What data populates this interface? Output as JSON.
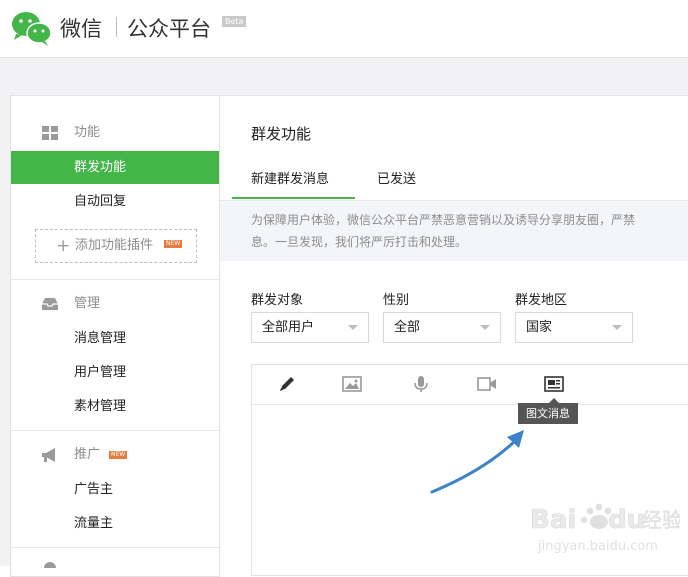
{
  "header": {
    "logo_wx": "微信",
    "logo_platform": "公众平台",
    "beta": "Beta"
  },
  "sidebar": {
    "groups": [
      {
        "title": "功能",
        "icon": "grid-icon"
      },
      {
        "title": "管理",
        "icon": "inbox-icon"
      },
      {
        "title": "推广",
        "icon": "megaphone-icon",
        "badge": "NEW"
      }
    ],
    "items": [
      {
        "label": "群发功能",
        "active": true
      },
      {
        "label": "自动回复"
      },
      {
        "label": "消息管理"
      },
      {
        "label": "用户管理"
      },
      {
        "label": "素材管理"
      },
      {
        "label": "广告主"
      },
      {
        "label": "流量主"
      }
    ],
    "plugin": {
      "label": "添加功能插件",
      "badge": "NEW"
    }
  },
  "main": {
    "title": "群发功能",
    "tabs": [
      {
        "label": "新建群发消息",
        "active": true
      },
      {
        "label": "已发送"
      }
    ],
    "notice": {
      "line1": "为保障用户体验，微信公众平台严禁恶意营销以及诱导分享朋友圈，严禁",
      "line2": "息。一旦发现，我们将严厉打击和处理。"
    },
    "fields": [
      {
        "label": "群发对象",
        "value": "全部用户"
      },
      {
        "label": "性别",
        "value": "全部"
      },
      {
        "label": "群发地区",
        "value": "国家"
      }
    ],
    "editor": {
      "tools": [
        "pencil-icon",
        "image-icon",
        "microphone-icon",
        "video-icon",
        "news-article-icon"
      ],
      "tooltip": "图文消息"
    }
  },
  "watermark": {
    "brand": "Bai",
    "brand_tail": "du",
    "cn": "经验",
    "url": "jingyan.baidu.com"
  },
  "colors": {
    "accent": "#44b549",
    "annotation_arrow": "#3b82c9",
    "new_badge": "#e87c3e"
  }
}
